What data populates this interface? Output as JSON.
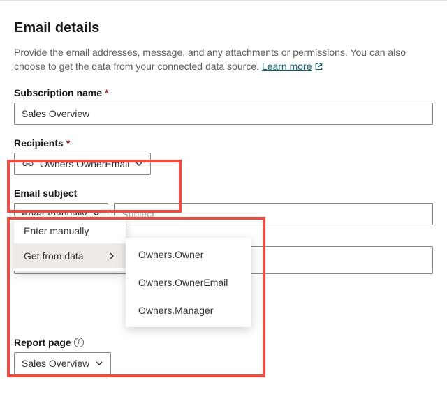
{
  "title": "Email details",
  "description_a": "Provide the email addresses, message, and any attachments or permissions. You can also choose to get the data from your connected data source. ",
  "learn_more_label": "Learn more",
  "fields": {
    "subscription": {
      "label": "Subscription name",
      "value": "Sales Overview"
    },
    "recipients": {
      "label": "Recipients",
      "chip": "Owners.OwnerEmail"
    },
    "subject": {
      "label": "Email subject",
      "dropdown_label": "Enter manually",
      "placeholder": "Subject",
      "menu": {
        "opt_manual": "Enter manually",
        "opt_data": "Get from data",
        "sub": {
          "a": "Owners.Owner",
          "b": "Owners.OwnerEmail",
          "c": "Owners.Manager"
        }
      }
    },
    "report_page": {
      "label": "Report page",
      "value": "Sales Overview"
    }
  }
}
